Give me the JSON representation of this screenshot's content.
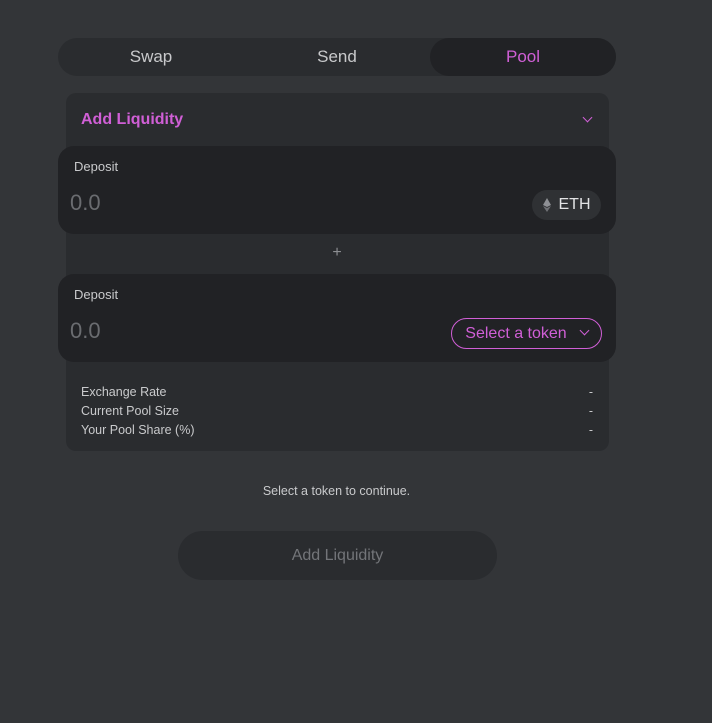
{
  "tabs": [
    {
      "label": "Swap"
    },
    {
      "label": "Send"
    },
    {
      "label": "Pool",
      "active": true
    }
  ],
  "panel": {
    "title": "Add Liquidity"
  },
  "deposits": [
    {
      "label": "Deposit",
      "placeholder": "0.0",
      "token": "ETH",
      "token_icon": "eth-icon"
    },
    {
      "label": "Deposit",
      "placeholder": "0.0",
      "token": "Select a token",
      "token_icon": "chevron-down-icon"
    }
  ],
  "plus_symbol": "+",
  "stats": [
    {
      "label": "Exchange Rate",
      "value": "-"
    },
    {
      "label": "Current Pool Size",
      "value": "-"
    },
    {
      "label": "Your Pool Share (%)",
      "value": "-"
    }
  ],
  "hint": "Select a token to continue.",
  "submit_label": "Add Liquidity",
  "colors": {
    "accent": "#d05fd6",
    "background": "#333538",
    "panel": "#2a2c2f",
    "card": "#212225"
  }
}
